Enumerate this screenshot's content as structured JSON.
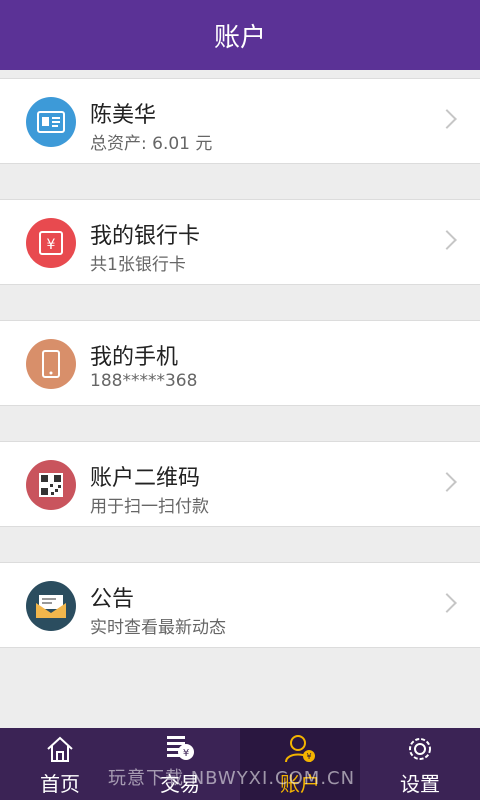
{
  "header": {
    "title": "账户"
  },
  "items": [
    {
      "title": "陈美华",
      "subtitle": "总资产: 6.01 元",
      "icon": "id-card-icon",
      "color": "#3d9ad8"
    },
    {
      "title": "我的银行卡",
      "subtitle": "共1张银行卡",
      "icon": "bank-card-icon",
      "color": "#e84a4f"
    },
    {
      "title": "我的手机",
      "subtitle": "188*****368",
      "icon": "phone-icon",
      "color": "#d88f6a"
    },
    {
      "title": "账户二维码",
      "subtitle": "用于扫一扫付款",
      "icon": "qr-code-icon",
      "color": "#c9545d"
    },
    {
      "title": "公告",
      "subtitle": "实时查看最新动态",
      "icon": "envelope-icon",
      "color": "#2b4d5f"
    }
  ],
  "tabbar": {
    "tabs": [
      {
        "label": "首页",
        "icon": "home-icon",
        "active": false
      },
      {
        "label": "交易",
        "icon": "trade-icon",
        "active": false
      },
      {
        "label": "账户",
        "icon": "account-icon",
        "active": true
      },
      {
        "label": "设置",
        "icon": "gear-icon",
        "active": false
      }
    ]
  },
  "watermark": "玩意下载 NBWYXI.COM.CN",
  "colors": {
    "primary": "#5b3296",
    "tabbar": "#3b2355",
    "active": "#f4b400"
  }
}
